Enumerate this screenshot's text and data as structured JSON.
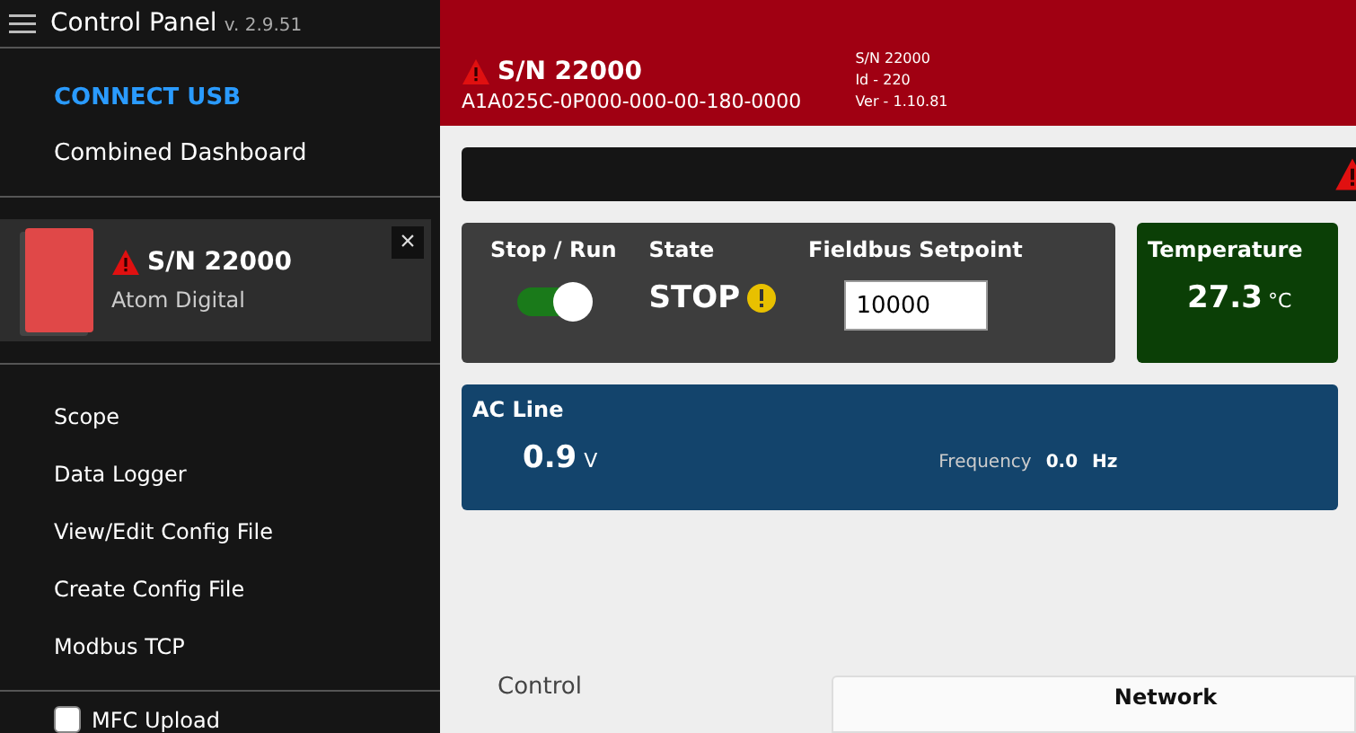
{
  "sidebar": {
    "title": "Control Panel",
    "version": "v. 2.9.51",
    "top_links": [
      {
        "label": "CONNECT USB",
        "kind": "action"
      },
      {
        "label": "Combined Dashboard",
        "kind": "link"
      }
    ],
    "device": {
      "serial": "S/N 22000",
      "model": "Atom Digital",
      "warning": true,
      "close": "×"
    },
    "menu": [
      "Scope",
      "Data Logger",
      "View/Edit Config File",
      "Create Config File",
      "Modbus TCP"
    ],
    "option": {
      "label": "MFC Upload",
      "checked": false
    }
  },
  "header": {
    "serial": "S/N 22000",
    "part_number": "A1A025C-0P000-000-00-180-0000",
    "warning": true,
    "info": [
      "S/N 22000",
      "Id - 220",
      "Ver - 1.10.81"
    ]
  },
  "alert_bar": {
    "warning": true
  },
  "control": {
    "stop_run_label": "Stop / Run",
    "run": {
      "on": true
    },
    "state_label": "State",
    "state": "STOP",
    "state_warning": true,
    "setpoint_label": "Fieldbus Setpoint",
    "setpoint": "10000"
  },
  "temperature": {
    "title": "Temperature",
    "value": "27.3",
    "unit": "°C"
  },
  "ac_line": {
    "title": "AC Line",
    "value": "0.9",
    "unit": "V",
    "frequency_label": "Frequency",
    "frequency": "0.0",
    "frequency_unit": "Hz"
  },
  "section": {
    "title": "Control"
  },
  "network": {
    "header": "Network"
  }
}
